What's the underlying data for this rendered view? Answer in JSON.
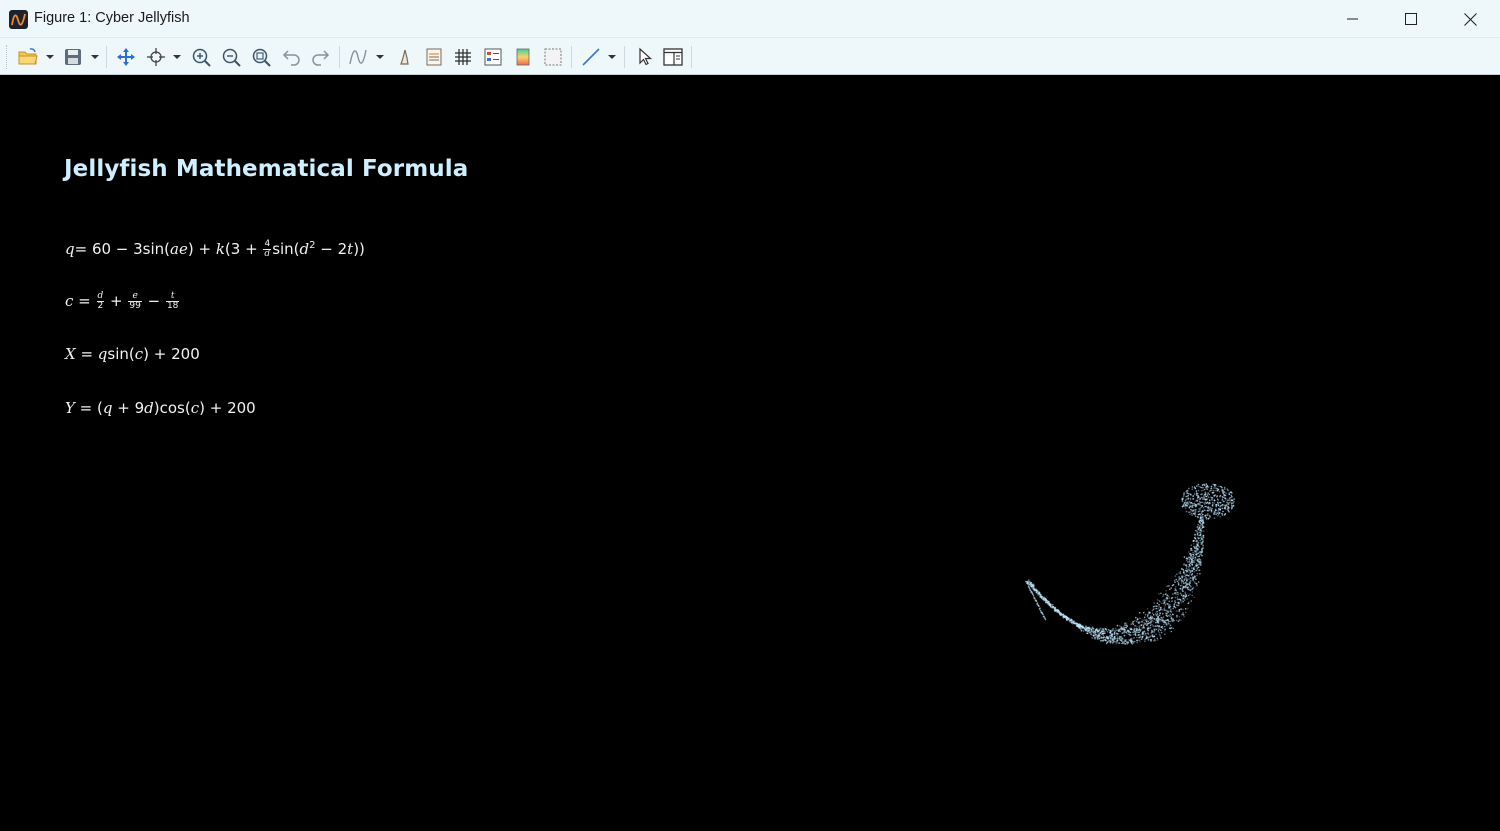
{
  "window": {
    "title": "Figure 1: Cyber Jellyfish",
    "app_icon": "matplotlib-app-icon",
    "controls": [
      "minimize",
      "maximize",
      "close"
    ]
  },
  "toolbar": {
    "buttons": [
      "open-folder-icon",
      "save-icon",
      "pan-icon",
      "select-point-icon",
      "zoom-in-icon",
      "zoom-out-icon",
      "zoom-fit-icon",
      "undo-icon",
      "redo-icon",
      "curve-fit-icon",
      "pen-icon",
      "axis-settings-icon",
      "grid-icon",
      "legend-icon",
      "colormap-icon",
      "border-icon",
      "line-style-icon",
      "cursor-icon",
      "panel-icon"
    ]
  },
  "figure": {
    "title": "Jellyfish Mathematical Formula",
    "colors": {
      "background": "#000000",
      "title": "#cfefff",
      "formula_text": "#f2f2f2",
      "jellyfish": "#bfe8ff"
    },
    "formulas": [
      {
        "id": "q",
        "text": "q = 60 − 3sin(ae) + k(3 + 4/d sin(d² − 2t))"
      },
      {
        "id": "c",
        "text": "c = d/2 + e/99 − t/18"
      },
      {
        "id": "X",
        "text": "X = qsin(c) + 200"
      },
      {
        "id": "Y",
        "text": "Y = (q + 9d)cos(c) + 200"
      }
    ],
    "formula_parts": {
      "q_eq": "= 60 − 3sin(",
      "q_ae": "ae",
      "q_k": ") + ",
      "q_kvar": "k",
      "q_open": "(3 + ",
      "q_four": "4",
      "q_d": "d",
      "q_sin": "sin(",
      "q_d2": "d",
      "q_sq": "2",
      "q_minus": " − 2",
      "q_t": "t",
      "q_close": "))",
      "c_eq": " = ",
      "c_d": "d",
      "c_two": "2",
      "c_plus": " + ",
      "c_e": "e",
      "c_99": "99",
      "c_minus": " − ",
      "c_t": "t",
      "c_18": "18",
      "x_eq": " = ",
      "x_q": "q",
      "x_sin": "sin(",
      "x_c": "c",
      "x_rest": ") + 200",
      "y_eq": " = (",
      "y_q": "q",
      "y_plus": " + 9",
      "y_d": "d",
      "y_cos": ")cos(",
      "y_c": "c",
      "y_rest": ") + 200"
    }
  }
}
